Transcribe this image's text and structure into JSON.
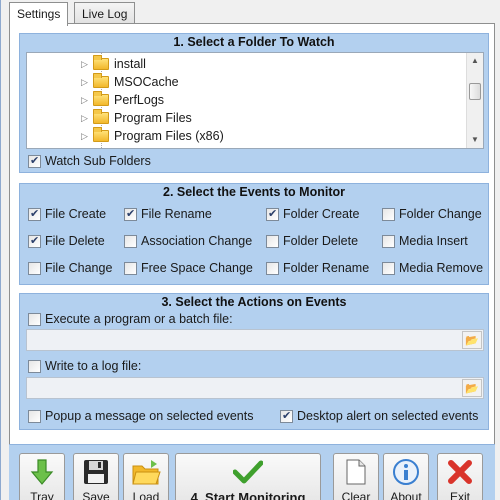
{
  "tabs": [
    {
      "label": "Settings",
      "active": true
    },
    {
      "label": "Live Log",
      "active": false
    }
  ],
  "group1": {
    "title": "1. Select a Folder To Watch",
    "tree": [
      "install",
      "MSOCache",
      "PerfLogs",
      "Program Files",
      "Program Files (x86)"
    ],
    "watch_sub_folders": {
      "label": "Watch Sub Folders",
      "checked": true
    }
  },
  "group2": {
    "title": "2. Select the Events to Monitor",
    "events": [
      {
        "label": "File Create",
        "checked": true
      },
      {
        "label": "File Rename",
        "checked": true
      },
      {
        "label": "Folder Create",
        "checked": true
      },
      {
        "label": "Folder Change",
        "checked": false
      },
      {
        "label": "File Delete",
        "checked": true
      },
      {
        "label": "Association Change",
        "checked": false
      },
      {
        "label": "Folder Delete",
        "checked": false
      },
      {
        "label": "Media Insert",
        "checked": false
      },
      {
        "label": "File Change",
        "checked": false
      },
      {
        "label": "Free Space Change",
        "checked": false
      },
      {
        "label": "Folder Rename",
        "checked": false
      },
      {
        "label": "Media Remove",
        "checked": false
      }
    ]
  },
  "group3": {
    "title": "3. Select the Actions on Events",
    "execute": {
      "label": "Execute a program or a batch file:",
      "checked": false,
      "value": ""
    },
    "write_log": {
      "label": "Write to a log file:",
      "checked": false,
      "value": ""
    },
    "popup": {
      "label": "Popup a message on selected events",
      "checked": false
    },
    "desktop_alert": {
      "label": "Desktop alert on selected events",
      "checked": true
    }
  },
  "toolbar": {
    "tray": "Tray",
    "save": "Save",
    "load": "Load",
    "start": "4. Start Monitoring",
    "clear": "Clear",
    "about": "About",
    "exit": "Exit"
  },
  "colors": {
    "group_bg": "#b3d0ef",
    "group_border": "#8eb2dd",
    "start_icon": "#3fa02d",
    "exit_icon": "#d9342b",
    "about_icon": "#3a7fd0"
  }
}
